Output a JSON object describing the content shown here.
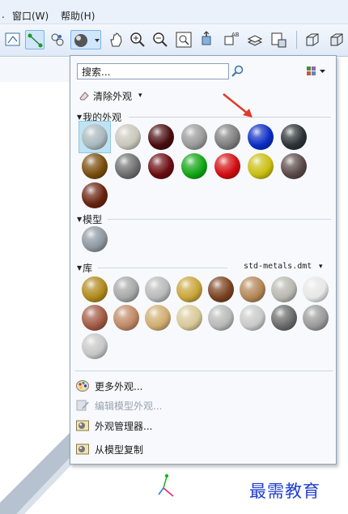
{
  "menubar": {
    "items": [
      ".",
      "窗口(W)",
      "帮助(H)"
    ]
  },
  "toolbar": {
    "icons": [
      "sketch-view-icon",
      "datum-curve-icon",
      "datum-point-icon",
      "appearance-sphere-icon",
      "dropdown-arrow-icon",
      "pan-hand-icon",
      "zoom-in-icon",
      "zoom-out-icon",
      "refit-icon",
      "reorient-icon",
      "saved-views-icon",
      "layers-icon",
      "model-display-icon",
      "wireframe-icon",
      "shaded-icon"
    ]
  },
  "panel": {
    "search_placeholder": "搜索...",
    "clear_label": "清除外观",
    "clear_arrow": "▾",
    "sections": {
      "my": {
        "title": "我的外观"
      },
      "model": {
        "title": "模型"
      },
      "library": {
        "title": "库",
        "file": "std-metals.dmt",
        "arrow": "▾"
      }
    },
    "colors": {
      "my": [
        "#a9b8bd",
        "#c9c7bc",
        "#4a0d10",
        "#9a9a9a",
        "#7e7e7e",
        "#0a2dc4",
        "#2c3336",
        "#7a4d0e",
        "#6e6e6e",
        "#6b0d12",
        "#12a615",
        "#d10d10",
        "#c9bf12",
        "#5a4a48",
        "#6a2410"
      ],
      "model": [
        "#8d97a0"
      ],
      "library": [
        "#b0891c",
        "#a7a7a7",
        "#b9b9b9",
        "#c8a43a",
        "#7a4220",
        "#b38656",
        "#b8b8b0",
        "#e6e6e6",
        "#a05a44",
        "#bf8866",
        "#d0ac70",
        "#d8c898",
        "#b8b8b8",
        "#c9c9c9",
        "#6a6a6a",
        "#9a9a9a",
        "#c6c6c6"
      ]
    },
    "menu": [
      {
        "label": "更多外观...",
        "enabled": true,
        "icon": "palette-icon"
      },
      {
        "label": "编辑模型外观...",
        "enabled": false,
        "icon": "edit-appearance-icon"
      },
      {
        "label": "外观管理器...",
        "enabled": true,
        "icon": "appearance-manager-icon"
      },
      {
        "label": "从模型复制",
        "enabled": true,
        "icon": "copy-from-model-icon"
      }
    ]
  },
  "watermark": "最需教育"
}
